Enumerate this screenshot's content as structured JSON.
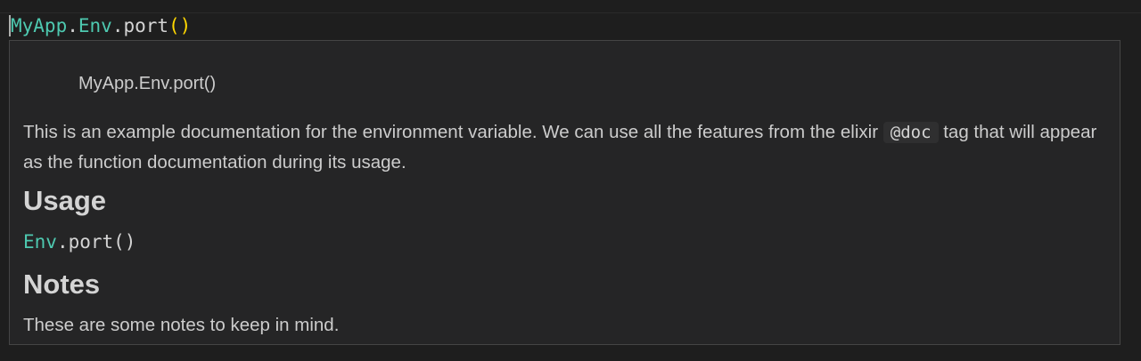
{
  "editor": {
    "code_tokens": [
      {
        "text": "MyApp",
        "kind": "module"
      },
      {
        "text": ".",
        "kind": "plain"
      },
      {
        "text": "Env",
        "kind": "module"
      },
      {
        "text": ".port",
        "kind": "plain"
      },
      {
        "text": "()",
        "kind": "paren"
      }
    ]
  },
  "hover": {
    "signature": "MyApp.Env.port()",
    "description_before": "This is an example documentation for the environment variable. We can use all the features from the elixir",
    "description_code": "@doc",
    "description_after": "tag that will appear as the function documentation during its usage.",
    "usage_heading": "Usage",
    "usage_code_module": "Env",
    "usage_code_rest": ".port()",
    "notes_heading": "Notes",
    "notes_text": "These are some notes to keep in mind."
  },
  "colors": {
    "background": "#1e1e1e",
    "hover_background": "#252526",
    "module": "#4ec9b0",
    "paren": "#ffd700",
    "text": "#cccccc"
  }
}
